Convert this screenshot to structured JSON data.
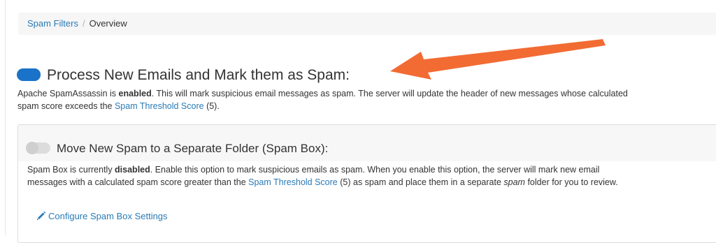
{
  "breadcrumb": {
    "parent": "Spam Filters",
    "separator": "/",
    "current": "Overview"
  },
  "process": {
    "toggle_state": "on",
    "title": "Process New Emails and Mark them as Spam:",
    "desc_prefix": "Apache SpamAssassin is ",
    "desc_status": "enabled",
    "desc_middle": ". This will mark suspicious email messages as spam. The server will update the header of new messages whose calculated spam score exceeds the ",
    "threshold_link": "Spam Threshold Score",
    "threshold_value": " (5)."
  },
  "spam_box": {
    "toggle_state": "off",
    "title": "Move New Spam to a Separate Folder (Spam Box):",
    "desc_prefix": "Spam Box is currently ",
    "desc_status": "disabled",
    "desc_middle": ". Enable this option to mark suspicious emails as spam. When you enable this option, the server will mark new email messages with a calculated spam score greater than the ",
    "threshold_link": "Spam Threshold Score",
    "desc_after_link": " (5) as spam and place them in a separate ",
    "desc_italic": "spam",
    "desc_end": " folder for you to review.",
    "configure_label": "Configure Spam Box Settings",
    "configure_icon": "pencil-icon"
  },
  "colors": {
    "accent": "#1a73c9",
    "link": "#2a7bb7",
    "arrow": "#f26b33"
  }
}
